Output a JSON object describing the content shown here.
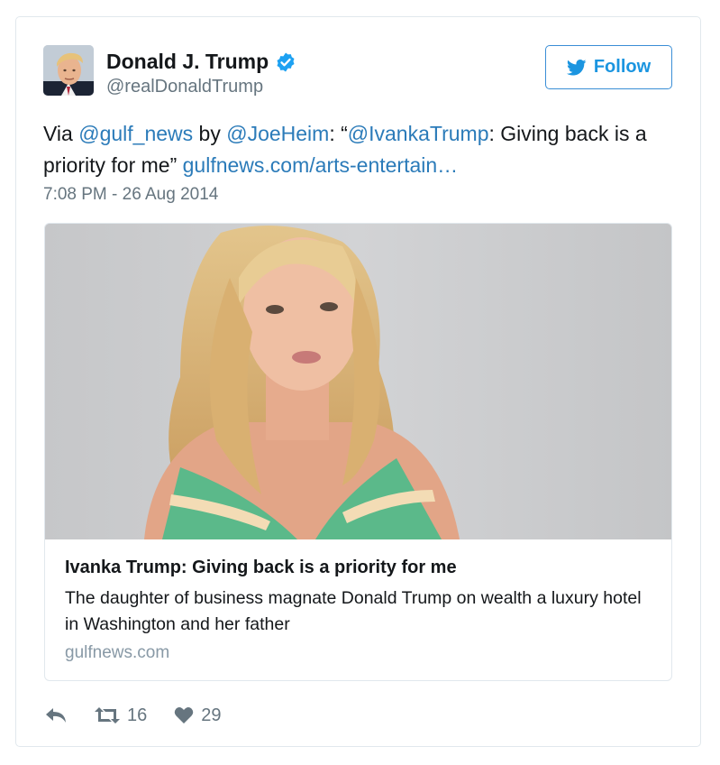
{
  "author": {
    "name": "Donald J. Trump",
    "handle": "@realDonaldTrump",
    "verified": true
  },
  "follow_button": {
    "label": "Follow",
    "icon": "twitter-bird-icon"
  },
  "tweet": {
    "parts": {
      "via": "Via ",
      "mention1": "@gulf_news",
      "by": " by ",
      "mention2": "@JoeHeim",
      "colon_quote": ": “",
      "mention3": "@IvankaTrump",
      "rest": ": Giving back is a priority for me” ",
      "link": "gulfnews.com/arts-entertain…"
    },
    "timestamp": "7:08 PM - 26 Aug 2014"
  },
  "card": {
    "title": "Ivanka Trump: Giving back is a priority for me",
    "description": "The daughter of business magnate Donald Trump on wealth a luxury hotel in Washington and her father",
    "domain": "gulfnews.com"
  },
  "actions": {
    "reply_icon": "reply-icon",
    "retweet_icon": "retweet-icon",
    "retweet_count": "16",
    "like_icon": "heart-icon",
    "like_count": "29"
  },
  "colors": {
    "link": "#2b7bb9",
    "follow": "#1b95e0",
    "verified": "#1da1f2",
    "muted": "#66757f"
  }
}
